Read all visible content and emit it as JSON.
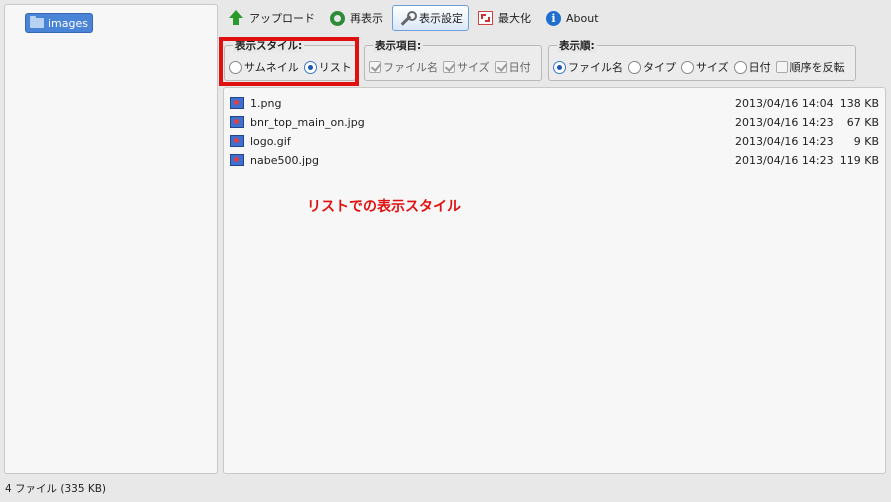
{
  "tree": {
    "folder_label": "images"
  },
  "toolbar": {
    "upload": "アップロード",
    "refresh": "再表示",
    "display_settings": "表示設定",
    "maximize": "最大化",
    "about": "About"
  },
  "display_style": {
    "legend": "表示スタイル:",
    "thumbnail": "サムネイル",
    "list": "リスト",
    "selected": "list"
  },
  "display_items": {
    "legend": "表示項目:",
    "filename": "ファイル名",
    "size": "サイズ",
    "date": "日付"
  },
  "sort_order": {
    "legend": "表示順:",
    "filename": "ファイル名",
    "type": "タイプ",
    "size": "サイズ",
    "date": "日付",
    "reverse": "順序を反転",
    "selected": "filename"
  },
  "files": [
    {
      "name": "1.png",
      "date": "2013/04/16 14:04",
      "size": "138 KB"
    },
    {
      "name": "bnr_top_main_on.jpg",
      "date": "2013/04/16 14:23",
      "size": "67 KB"
    },
    {
      "name": "logo.gif",
      "date": "2013/04/16 14:23",
      "size": "9 KB"
    },
    {
      "name": "nabe500.jpg",
      "date": "2013/04/16 14:23",
      "size": "119 KB"
    }
  ],
  "annotation": "リストでの表示スタイル",
  "status": "4 ファイル (335 KB)",
  "colors": {
    "highlight": "#e01010",
    "selection": "#4a84d6"
  }
}
